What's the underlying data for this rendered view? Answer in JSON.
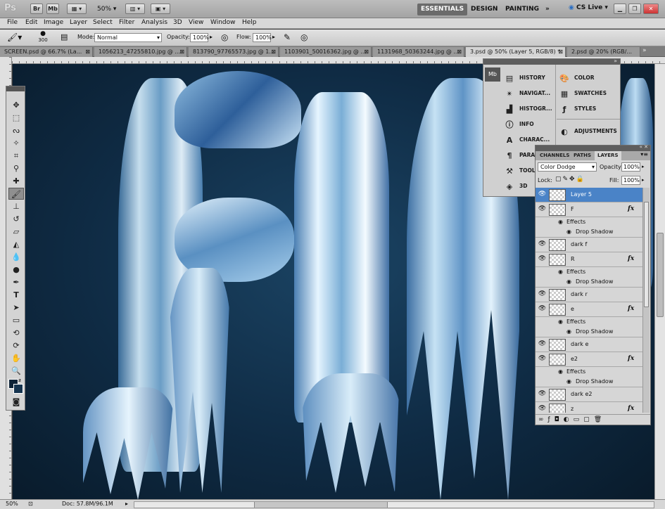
{
  "app": {
    "logo": "Ps",
    "bridge_btn": "Br",
    "minibridge_btn": "Mb",
    "zoom": "50%",
    "workspaces": [
      "ESSENTIALS",
      "DESIGN",
      "PAINTING"
    ],
    "more": "»",
    "cslive": "CS Live"
  },
  "menu": [
    "File",
    "Edit",
    "Image",
    "Layer",
    "Select",
    "Filter",
    "Analysis",
    "3D",
    "View",
    "Window",
    "Help"
  ],
  "options": {
    "brush_size": "300",
    "mode_label": "Mode:",
    "mode_value": "Normal",
    "opacity_label": "Opacity:",
    "opacity_value": "100%",
    "flow_label": "Flow:",
    "flow_value": "100%"
  },
  "doc_tabs": [
    {
      "label": "SCREEN.psd @ 66.7% (La...",
      "active": false
    },
    {
      "label": "1056213_47255810.jpg @ ...",
      "active": false
    },
    {
      "label": "813790_97765573.jpg @ 1...",
      "active": false
    },
    {
      "label": "1103901_50016362.jpg @ ...",
      "active": false
    },
    {
      "label": "1131968_50363244.jpg @ ...",
      "active": false
    },
    {
      "label": "3.psd @ 50% (Layer 5, RGB/8) *",
      "active": true
    },
    {
      "label": "2.psd @ 20% (RGB/...",
      "active": false
    }
  ],
  "dock_left": [
    "HISTORY",
    "NAVIGAT...",
    "HISTOGR...",
    "INFO",
    "CHARAC...",
    "PARA...",
    "TOOL...",
    "3D"
  ],
  "dock_right": [
    "COLOR",
    "SWATCHES",
    "STYLES",
    "ADJUSTMENTS"
  ],
  "layers_panel": {
    "tabs": [
      "CHANNELS",
      "PATHS",
      "LAYERS"
    ],
    "blend_mode": "Color Dodge",
    "opacity_label": "Opacity:",
    "opacity_value": "100%",
    "lock_label": "Lock:",
    "fill_label": "Fill:",
    "fill_value": "100%",
    "rows": [
      {
        "type": "layer",
        "name": "Layer 5",
        "selected": true,
        "fx": false
      },
      {
        "type": "layer",
        "name": "F",
        "selected": false,
        "fx": true
      },
      {
        "type": "effects",
        "name": "Effects"
      },
      {
        "type": "effect",
        "name": "Drop Shadow"
      },
      {
        "type": "layer",
        "name": "dark f",
        "selected": false,
        "fx": false
      },
      {
        "type": "layer",
        "name": "R",
        "selected": false,
        "fx": true
      },
      {
        "type": "effects",
        "name": "Effects"
      },
      {
        "type": "effect",
        "name": "Drop Shadow"
      },
      {
        "type": "layer",
        "name": "dark r",
        "selected": false,
        "fx": false
      },
      {
        "type": "layer",
        "name": "e",
        "selected": false,
        "fx": true
      },
      {
        "type": "effects",
        "name": "Effects"
      },
      {
        "type": "effect",
        "name": "Drop Shadow"
      },
      {
        "type": "layer",
        "name": "dark e",
        "selected": false,
        "fx": false
      },
      {
        "type": "layer",
        "name": "e2",
        "selected": false,
        "fx": true
      },
      {
        "type": "effects",
        "name": "Effects"
      },
      {
        "type": "effect",
        "name": "Drop Shadow"
      },
      {
        "type": "layer",
        "name": "dark e2",
        "selected": false,
        "fx": false
      },
      {
        "type": "layer",
        "name": "z",
        "selected": false,
        "fx": true
      }
    ],
    "fx_glyph": "fx"
  },
  "status": {
    "zoom": "50%",
    "doc": "Doc: 57.8M/96.1M"
  },
  "colors": {
    "foreground": "#0d2236",
    "background": "#16344f",
    "selection": "#4a83c7"
  }
}
